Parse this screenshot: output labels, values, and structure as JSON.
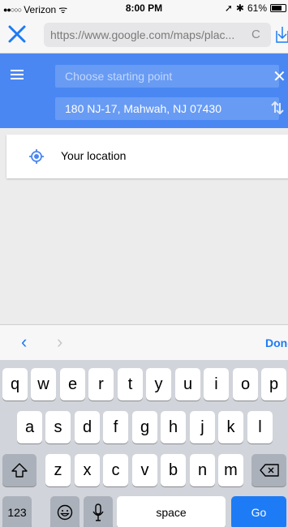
{
  "status": {
    "signal": "●●○○○",
    "carrier": "Verizon",
    "wifi": "ᯤ",
    "time": "8:00 PM",
    "location_arrow": "➚",
    "bluetooth": "✱",
    "battery": "61%"
  },
  "browser": {
    "url": "https://www.google.com/maps/plac...",
    "reload": "C"
  },
  "directions": {
    "start_placeholder": "Choose starting point",
    "destination": "180 NJ-17, Mahwah, NJ 07430",
    "close": "✕"
  },
  "suggestions": [
    {
      "label": "Your location",
      "icon": "my-location-icon"
    }
  ],
  "accessory": {
    "prev": "‹",
    "next": "›",
    "done": "Done"
  },
  "keyboard": {
    "row1": [
      "q",
      "w",
      "e",
      "r",
      "t",
      "y",
      "u",
      "i",
      "o",
      "p"
    ],
    "row2": [
      "a",
      "s",
      "d",
      "f",
      "g",
      "h",
      "j",
      "k",
      "l"
    ],
    "row3": [
      "z",
      "x",
      "c",
      "v",
      "b",
      "n",
      "m"
    ],
    "numbers": "123",
    "space": "space",
    "go": "Go"
  },
  "colors": {
    "accent": "#4a87f2",
    "ios_blue": "#1d7bf5"
  }
}
